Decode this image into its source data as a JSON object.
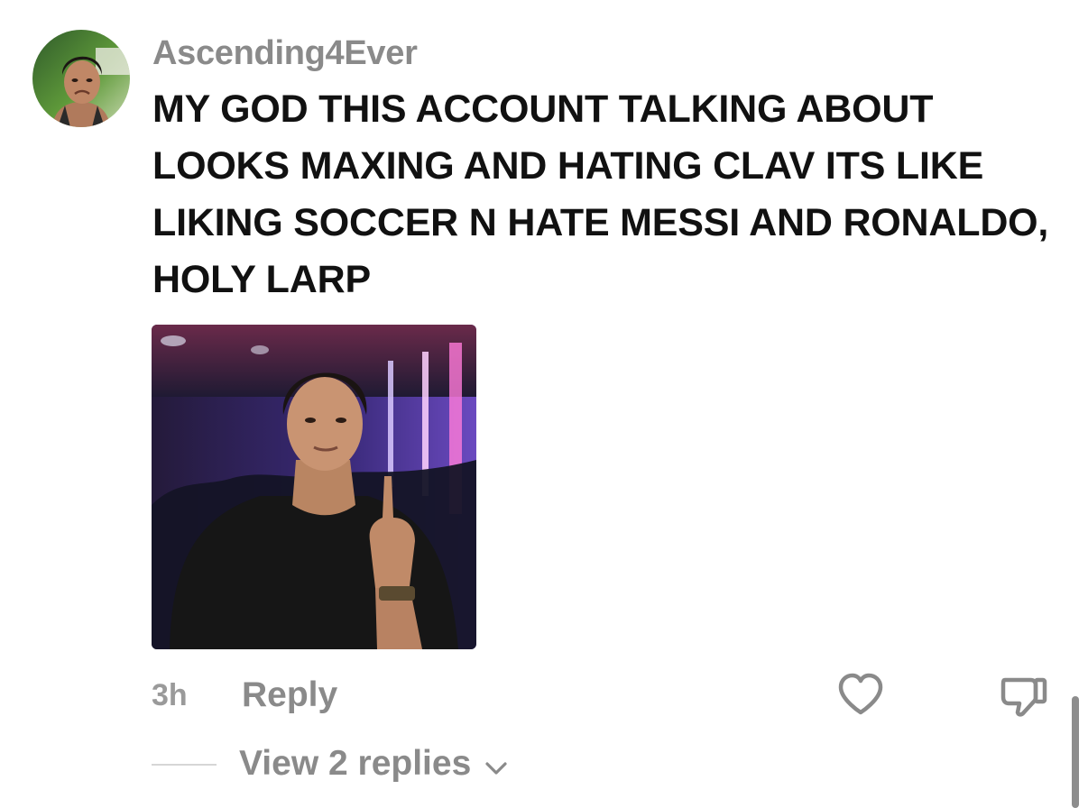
{
  "comment": {
    "username": "Ascending4Ever",
    "text": "MY GOD THIS ACCOUNT TALKING ABOUT LOOKS MAXING AND HATING CLAV ITS LIKE LIKING SOCCER N HATE MESSI AND RONALDO, HOLY LARP",
    "time": "3h",
    "reply_label": "Reply",
    "view_replies_label": "View 2 replies"
  },
  "icons": {
    "like": "heart-icon",
    "dislike": "thumbs-down-icon",
    "expand": "chevron-down-icon"
  },
  "colors": {
    "username": "#8a8a8a",
    "text": "#111111",
    "muted": "#9a9a9a",
    "background": "#ffffff"
  }
}
